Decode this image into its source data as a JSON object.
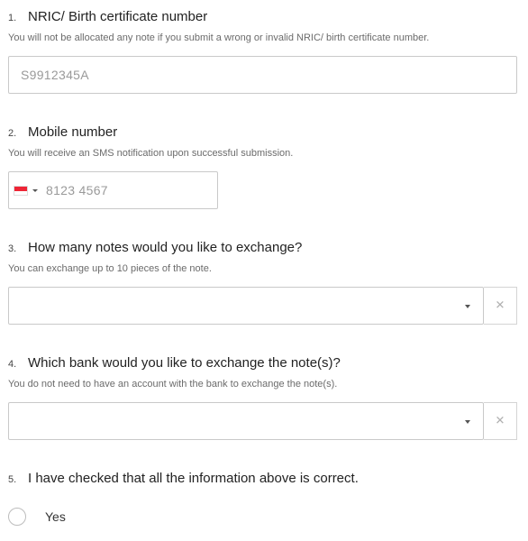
{
  "q1": {
    "number": "1.",
    "title": "NRIC/ Birth certificate number",
    "description": "You will not be allocated any note if you submit a wrong or invalid NRIC/ birth certificate number.",
    "placeholder": "S9912345A"
  },
  "q2": {
    "number": "2.",
    "title": "Mobile number",
    "description": "You will receive an SMS notification upon successful submission.",
    "country_flag": "singapore-flag-icon",
    "placeholder": "8123 4567"
  },
  "q3": {
    "number": "3.",
    "title": "How many notes would you like to exchange?",
    "description": "You can exchange up to 10 pieces of the note.",
    "value": "",
    "clear_symbol": "✕"
  },
  "q4": {
    "number": "4.",
    "title": "Which bank would you like to exchange the note(s)?",
    "description": "You do not need to have an account with the bank to exchange the note(s).",
    "value": "",
    "clear_symbol": "✕"
  },
  "q5": {
    "number": "5.",
    "title": "I have checked that all the information above is correct.",
    "option_label": "Yes"
  },
  "colors": {
    "border": "#c9c9c9",
    "placeholder": "#9a9a9a",
    "flag_red": "#ee2536"
  }
}
